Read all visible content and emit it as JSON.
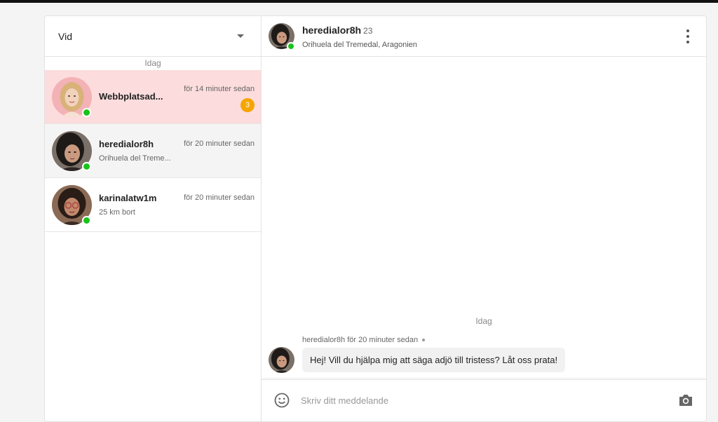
{
  "sidebar": {
    "filter": {
      "label": "Vid"
    },
    "day_separator": "Idag",
    "conversations": [
      {
        "name": "Webbplatsad...",
        "subtitle": "",
        "time": "för 14 minuter sedan",
        "unread": "3",
        "online": true
      },
      {
        "name": "heredialor8h",
        "subtitle": "Orihuela del Treme...",
        "time": "för 20 minuter sedan",
        "unread": "",
        "online": true
      },
      {
        "name": "karinalatw1m",
        "subtitle": "25 km bort",
        "time": "för 20 minuter sedan",
        "unread": "",
        "online": true
      }
    ]
  },
  "chat": {
    "header": {
      "name": "heredialor8h",
      "age": "23",
      "location": "Orihuela del Tremedal, Aragonien"
    },
    "day_separator": "Idag",
    "messages": [
      {
        "sender": "heredialor8h",
        "time": "för 20 minuter sedan",
        "text": "Hej! Vill du hjälpa mig att säga adjö till tristess? Låt oss prata!"
      }
    ],
    "composer": {
      "placeholder": "Skriv ditt meddelande"
    }
  },
  "colors": {
    "online": "#19c319",
    "badge": "#f5a500",
    "active_row": "#fcdcdc"
  },
  "icons": [
    "chevron-down-icon",
    "more-vertical-icon",
    "emoji-icon",
    "camera-icon"
  ]
}
